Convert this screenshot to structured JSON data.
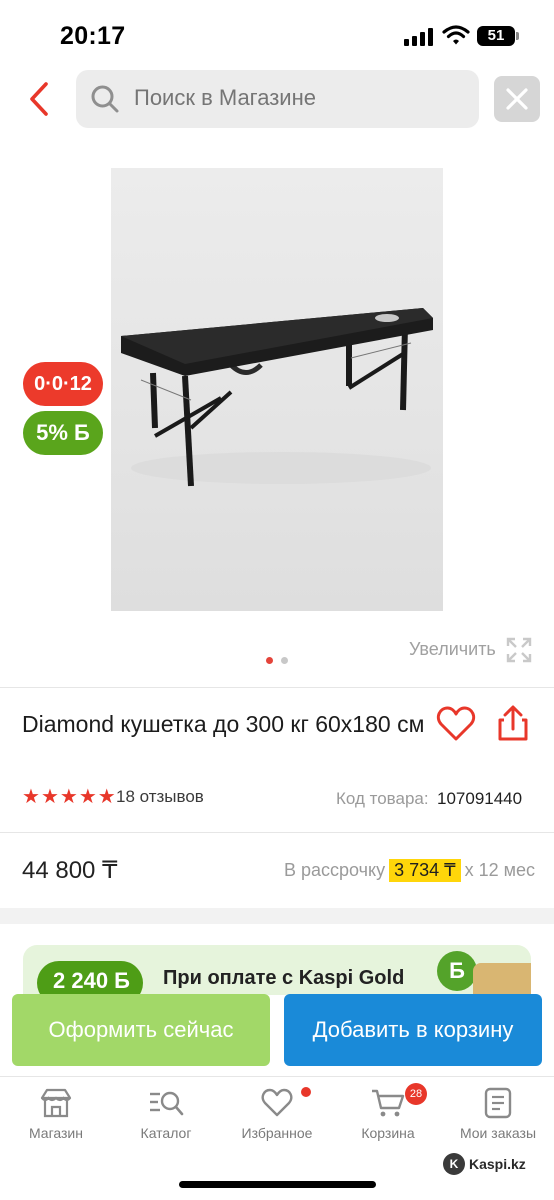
{
  "status_bar": {
    "time": "20:17",
    "battery": "51"
  },
  "search": {
    "placeholder": "Поиск в Магазине"
  },
  "product": {
    "installment_badge": "0·0·12",
    "bonus_badge": "5% Б",
    "zoom_label": "Увеличить",
    "title": "Diamond кушетка до 300 кг 60x180 см",
    "rating_stars": 5,
    "reviews": "18 отзывов",
    "code_label": "Код товара:",
    "code_value": "107091440",
    "price": "44 800 ₸",
    "installment_prefix": "В рассрочку",
    "installment_amount": "3 734 ₸",
    "installment_suffix": "х 12 мес"
  },
  "promo": {
    "bonus_amount": "2 240 Б",
    "text": "При оплате с Kaspi Gold",
    "coin_label": "Б"
  },
  "actions": {
    "buy_now": "Оформить сейчас",
    "add_to_cart": "Добавить в корзину"
  },
  "tabbar": {
    "items": [
      {
        "label": "Магазин",
        "icon": "store-icon"
      },
      {
        "label": "Каталог",
        "icon": "catalog-search-icon"
      },
      {
        "label": "Избранное",
        "icon": "heart-icon"
      },
      {
        "label": "Корзина",
        "icon": "cart-icon",
        "badge": "28"
      },
      {
        "label": "Мои заказы",
        "icon": "orders-icon"
      }
    ]
  },
  "watermark": {
    "text": "Kaspi.kz",
    "logo": "K"
  },
  "colors": {
    "accent_red": "#e8372a",
    "bonus_green": "#5aa51c",
    "buy_button": "#a2d868",
    "cart_button": "#1a8ad8",
    "installment_highlight": "#ffd60a"
  }
}
